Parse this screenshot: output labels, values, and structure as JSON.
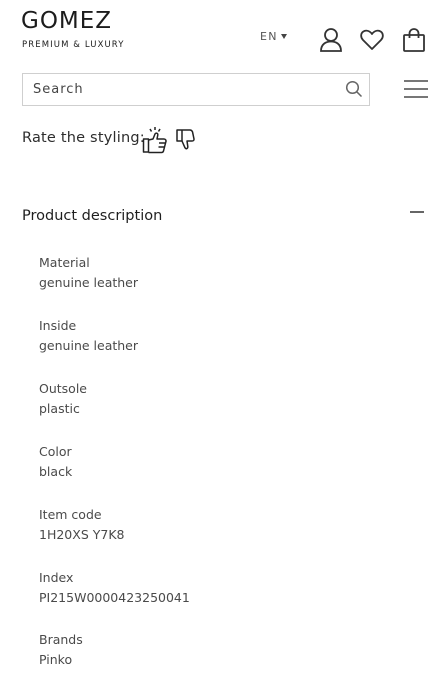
{
  "header": {
    "brand": "GOMEZ",
    "tagline": "PREMIUM & LUXURY",
    "language": "EN"
  },
  "search": {
    "placeholder": "Search"
  },
  "rating": {
    "label": "Rate the styling:"
  },
  "product_description": {
    "title": "Product description",
    "attributes": [
      {
        "key": "Material",
        "value": "genuine leather"
      },
      {
        "key": "Inside",
        "value": "genuine leather"
      },
      {
        "key": "Outsole",
        "value": "plastic"
      },
      {
        "key": "Color",
        "value": "black"
      },
      {
        "key": "Item code",
        "value": "1H20XS Y7K8"
      },
      {
        "key": "Index",
        "value": "PI215W0000423250041"
      },
      {
        "key": "Brands",
        "value": "Pinko"
      }
    ]
  }
}
